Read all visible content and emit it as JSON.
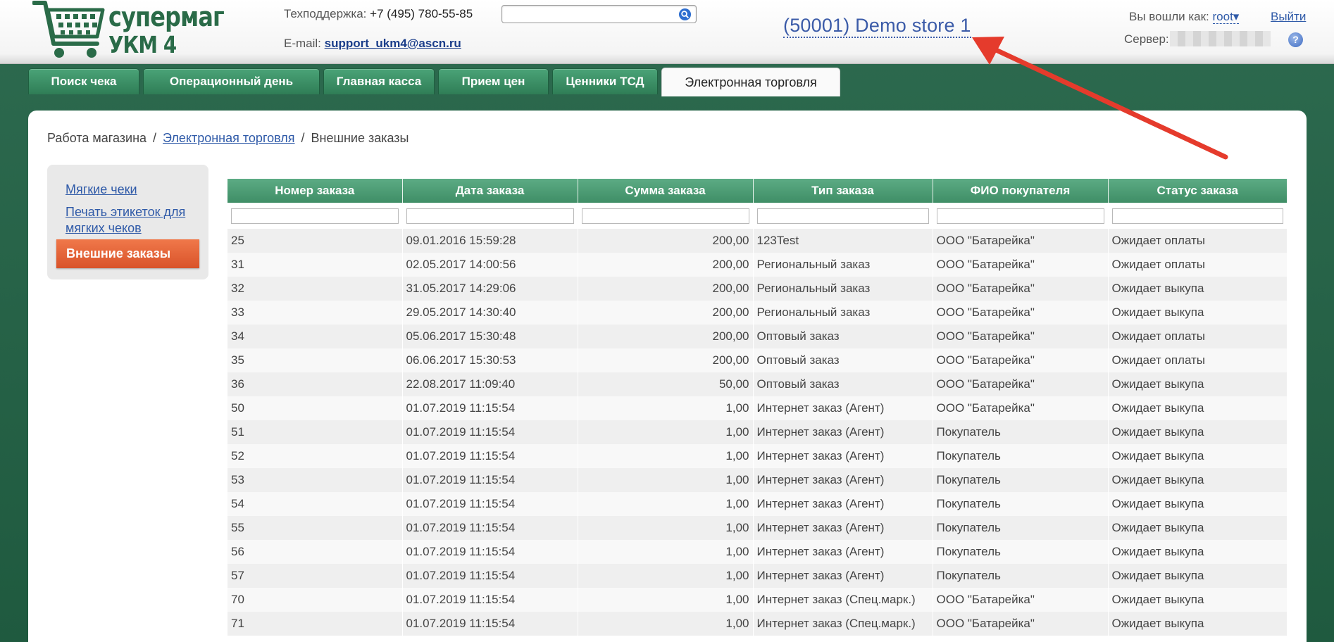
{
  "header": {
    "logo_line1": "супермаг",
    "logo_line2": "УКМ 4",
    "support_label": "Техподдержка:",
    "support_phone": "+7 (495) 780-55-85",
    "email_label": "E-mail:",
    "email_value": "support_ukm4@ascn.ru",
    "search_value": "",
    "store_name": "(50001) Demo store 1",
    "login_label": "Вы вошли как:",
    "user": "root▾",
    "logout": "Выйти",
    "server_label": "Сервер:",
    "help": "?"
  },
  "tabs": [
    {
      "label": "Поиск чека"
    },
    {
      "label": "Операционный день"
    },
    {
      "label": "Главная касса"
    },
    {
      "label": "Прием цен"
    },
    {
      "label": "Ценники ТСД"
    },
    {
      "label": "Электронная торговля"
    }
  ],
  "breadcrumb": {
    "item1": "Работа магазина",
    "sep1": "/",
    "item2": "Электронная торговля",
    "sep2": "/",
    "item3": "Внешние заказы"
  },
  "sidebar": {
    "item1": "Мягкие чеки",
    "item2_line1": "Печать этикеток для",
    "item2_line2": "мягких чеков",
    "active": "Внешние заказы"
  },
  "table": {
    "headers": [
      "Номер заказа",
      "Дата заказа",
      "Сумма заказа",
      "Тип заказа",
      "ФИО покупателя",
      "Статус заказа"
    ],
    "rows": [
      [
        "25",
        "09.01.2016 15:59:28",
        "200,00",
        "123Test",
        "ООО \"Батарейка\"",
        "Ожидает оплаты"
      ],
      [
        "31",
        "02.05.2017 14:00:56",
        "200,00",
        "Региональный заказ",
        "ООО \"Батарейка\"",
        "Ожидает оплаты"
      ],
      [
        "32",
        "31.05.2017 14:29:06",
        "200,00",
        "Региональный заказ",
        "ООО \"Батарейка\"",
        "Ожидает выкупа"
      ],
      [
        "33",
        "29.05.2017 14:30:40",
        "200,00",
        "Региональный заказ",
        "ООО \"Батарейка\"",
        "Ожидает выкупа"
      ],
      [
        "34",
        "05.06.2017 15:30:48",
        "200,00",
        "Оптовый заказ",
        "ООО \"Батарейка\"",
        "Ожидает оплаты"
      ],
      [
        "35",
        "06.06.2017 15:30:53",
        "200,00",
        "Оптовый заказ",
        "ООО \"Батарейка\"",
        "Ожидает оплаты"
      ],
      [
        "36",
        "22.08.2017 11:09:40",
        "50,00",
        "Оптовый заказ",
        "ООО \"Батарейка\"",
        "Ожидает выкупа"
      ],
      [
        "50",
        "01.07.2019 11:15:54",
        "1,00",
        "Интернет заказ (Агент)",
        "ООО \"Батарейка\"",
        "Ожидает выкупа"
      ],
      [
        "51",
        "01.07.2019 11:15:54",
        "1,00",
        "Интернет заказ (Агент)",
        "Покупатель",
        "Ожидает выкупа"
      ],
      [
        "52",
        "01.07.2019 11:15:54",
        "1,00",
        "Интернет заказ (Агент)",
        "Покупатель",
        "Ожидает выкупа"
      ],
      [
        "53",
        "01.07.2019 11:15:54",
        "1,00",
        "Интернет заказ (Агент)",
        "Покупатель",
        "Ожидает выкупа"
      ],
      [
        "54",
        "01.07.2019 11:15:54",
        "1,00",
        "Интернет заказ (Агент)",
        "Покупатель",
        "Ожидает выкупа"
      ],
      [
        "55",
        "01.07.2019 11:15:54",
        "1,00",
        "Интернет заказ (Агент)",
        "Покупатель",
        "Ожидает выкупа"
      ],
      [
        "56",
        "01.07.2019 11:15:54",
        "1,00",
        "Интернет заказ (Агент)",
        "Покупатель",
        "Ожидает выкупа"
      ],
      [
        "57",
        "01.07.2019 11:15:54",
        "1,00",
        "Интернет заказ (Агент)",
        "Покупатель",
        "Ожидает выкупа"
      ],
      [
        "70",
        "01.07.2019 11:15:54",
        "1,00",
        "Интернет заказ (Спец.марк.)",
        "ООО \"Батарейка\"",
        "Ожидает выкупа"
      ],
      [
        "71",
        "01.07.2019 11:15:54",
        "1,00",
        "Интернет заказ (Спец.марк.)",
        "ООО \"Батарейка\"",
        "Ожидает выкупа"
      ]
    ]
  },
  "colors": {
    "accent_green": "#3f8e66",
    "background_green": "#2d6a4f",
    "active_orange": "#e0622f",
    "link_blue": "#2f5aa8",
    "annotation_arrow": "#e53b2c"
  }
}
